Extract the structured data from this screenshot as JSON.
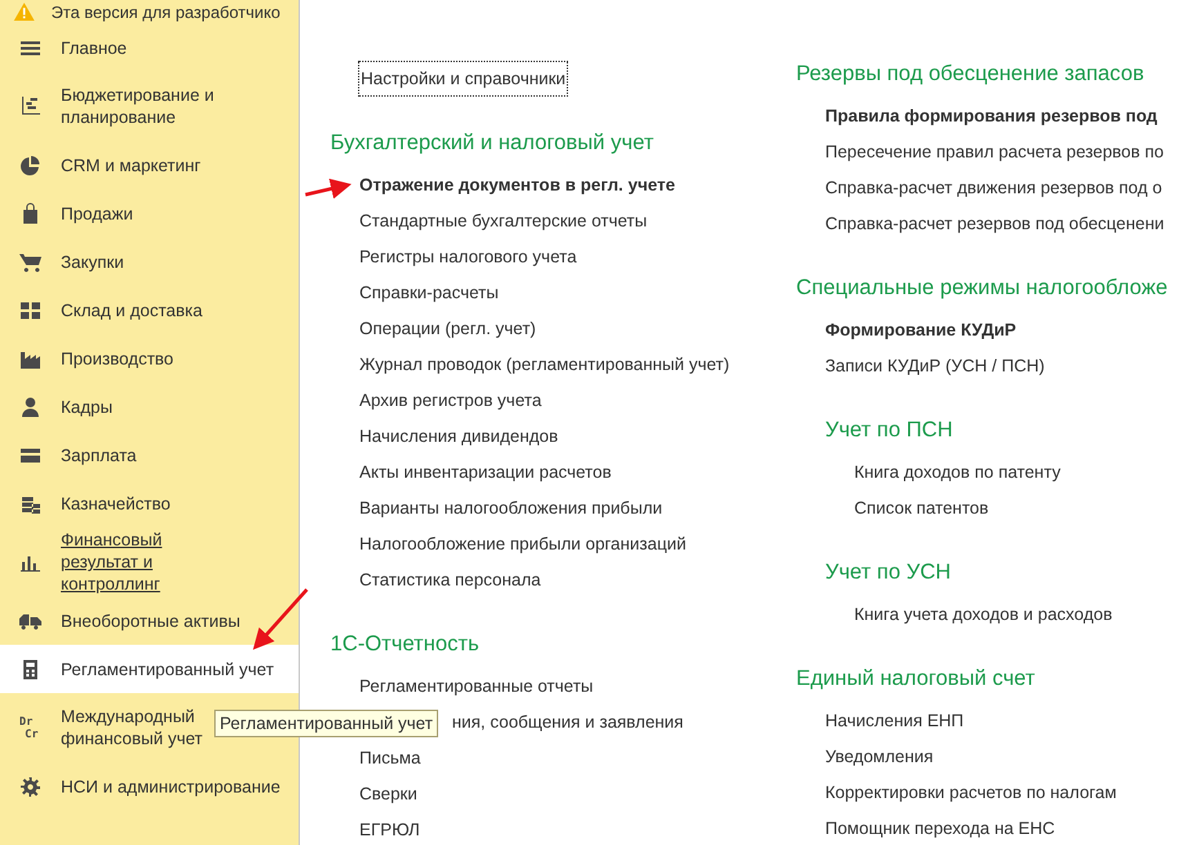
{
  "banner": {
    "text": "Эта версия для разработчико"
  },
  "sidebar": {
    "items": [
      {
        "label": "Главное",
        "selected": false,
        "hovered": false
      },
      {
        "label": "Бюджетирование и планирование",
        "selected": false,
        "hovered": false
      },
      {
        "label": "CRM и маркетинг",
        "selected": false,
        "hovered": false
      },
      {
        "label": "Продажи",
        "selected": false,
        "hovered": false
      },
      {
        "label": "Закупки",
        "selected": false,
        "hovered": false
      },
      {
        "label": "Склад и доставка",
        "selected": false,
        "hovered": false
      },
      {
        "label": "Производство",
        "selected": false,
        "hovered": false
      },
      {
        "label": "Кадры",
        "selected": false,
        "hovered": false
      },
      {
        "label": "Зарплата",
        "selected": false,
        "hovered": false
      },
      {
        "label": "Казначейство",
        "selected": false,
        "hovered": false
      },
      {
        "label": "Финансовый результат и контроллинг",
        "selected": false,
        "hovered": true
      },
      {
        "label": "Внеоборотные активы",
        "selected": false,
        "hovered": false
      },
      {
        "label": "Регламентированный учет",
        "selected": true,
        "hovered": false
      },
      {
        "label": "Международный финансовый учет",
        "selected": false,
        "hovered": false,
        "icon_lines": [
          "Dr",
          "Cr"
        ]
      },
      {
        "label": "НСИ и администрирование",
        "selected": false,
        "hovered": false
      }
    ]
  },
  "tooltip": {
    "text": "Регламентированный учет"
  },
  "content": {
    "settings_link": {
      "label": "Настройки и справочники",
      "focused": true
    },
    "columns": [
      [
        {
          "title": "Бухгалтерский и налоговый учет",
          "items": [
            {
              "label": "Отражение документов в регл. учете",
              "bold": true
            },
            {
              "label": "Стандартные бухгалтерские отчеты",
              "bold": false
            },
            {
              "label": "Регистры налогового учета",
              "bold": false
            },
            {
              "label": "Справки-расчеты",
              "bold": false
            },
            {
              "label": "Операции (регл. учет)",
              "bold": false
            },
            {
              "label": "Журнал проводок (регламентированный учет)",
              "bold": false
            },
            {
              "label": "Архив регистров учета",
              "bold": false
            },
            {
              "label": "Начисления дивидендов",
              "bold": false
            },
            {
              "label": "Акты инвентаризации расчетов",
              "bold": false
            },
            {
              "label": "Варианты налогообложения прибыли",
              "bold": false
            },
            {
              "label": "Налогообложение прибыли организаций",
              "bold": false
            },
            {
              "label": "Статистика персонала",
              "bold": false
            }
          ]
        },
        {
          "title": "1С-Отчетность",
          "items": [
            {
              "label": "Регламентированные отчеты",
              "bold": false
            },
            {
              "label": "ния, сообщения и заявления",
              "bold": false,
              "covered": true
            },
            {
              "label": "Письма",
              "bold": false
            },
            {
              "label": "Сверки",
              "bold": false
            },
            {
              "label": "ЕГРЮЛ",
              "bold": false
            }
          ]
        }
      ],
      [
        {
          "title": "Резервы под обесценение запасов",
          "items": [
            {
              "label": "Правила формирования резервов под",
              "bold": true
            },
            {
              "label": "Пересечение правил расчета резервов по",
              "bold": false
            },
            {
              "label": "Справка-расчет движения резервов под о",
              "bold": false
            },
            {
              "label": "Справка-расчет резервов под обесценени",
              "bold": false
            }
          ]
        },
        {
          "title": "Специальные режимы налогообложе",
          "items": [
            {
              "label": "Формирование КУДиР",
              "bold": true
            },
            {
              "label": "Записи КУДиР (УСН / ПСН)",
              "bold": false
            }
          ],
          "children": [
            {
              "title": "Учет по ПСН",
              "items": [
                {
                  "label": "Книга доходов по патенту",
                  "bold": false
                },
                {
                  "label": "Список патентов",
                  "bold": false
                }
              ]
            },
            {
              "title": "Учет по УСН",
              "items": [
                {
                  "label": "Книга учета доходов и расходов",
                  "bold": false
                }
              ]
            }
          ]
        },
        {
          "title": "Единый налоговый счет",
          "items": [
            {
              "label": "Начисления ЕНП",
              "bold": false
            },
            {
              "label": "Уведомления",
              "bold": false
            },
            {
              "label": "Корректировки расчетов по налогам",
              "bold": false
            },
            {
              "label": "Помощник перехода на ЕНС",
              "bold": false
            }
          ]
        }
      ]
    ]
  }
}
